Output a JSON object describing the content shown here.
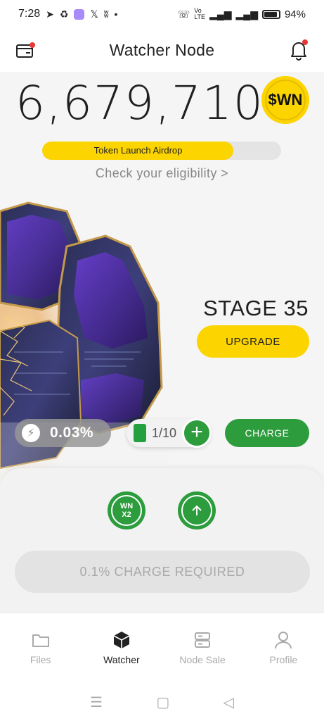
{
  "status_bar": {
    "time": "7:28",
    "battery_percent": "94%"
  },
  "header": {
    "title": "Watcher Node"
  },
  "balance": {
    "amount": "6,679,710",
    "token_symbol": "$WN"
  },
  "airdrop": {
    "label": "Token Launch Airdrop",
    "progress": 0.8,
    "eligibility_text": "Check your eligibility >"
  },
  "node": {
    "stage_label": "STAGE 35",
    "upgrade_label": "UPGRADE",
    "speed_value": "0.03%",
    "battery_count": "1/10",
    "charge_label": "CHARGE"
  },
  "actions": {
    "boost_label": "WN X2",
    "required_label": "0.1% CHARGE REQUIRED"
  },
  "bottom_nav": {
    "items": [
      {
        "label": "Files",
        "icon": "folder-icon",
        "active": false
      },
      {
        "label": "Watcher",
        "icon": "cube-icon",
        "active": true
      },
      {
        "label": "Node Sale",
        "icon": "server-icon",
        "active": false
      },
      {
        "label": "Profile",
        "icon": "person-icon",
        "active": false
      }
    ]
  },
  "colors": {
    "accent_yellow": "#fcd400",
    "accent_green": "#2c9c3c",
    "notification_red": "#e53935"
  }
}
